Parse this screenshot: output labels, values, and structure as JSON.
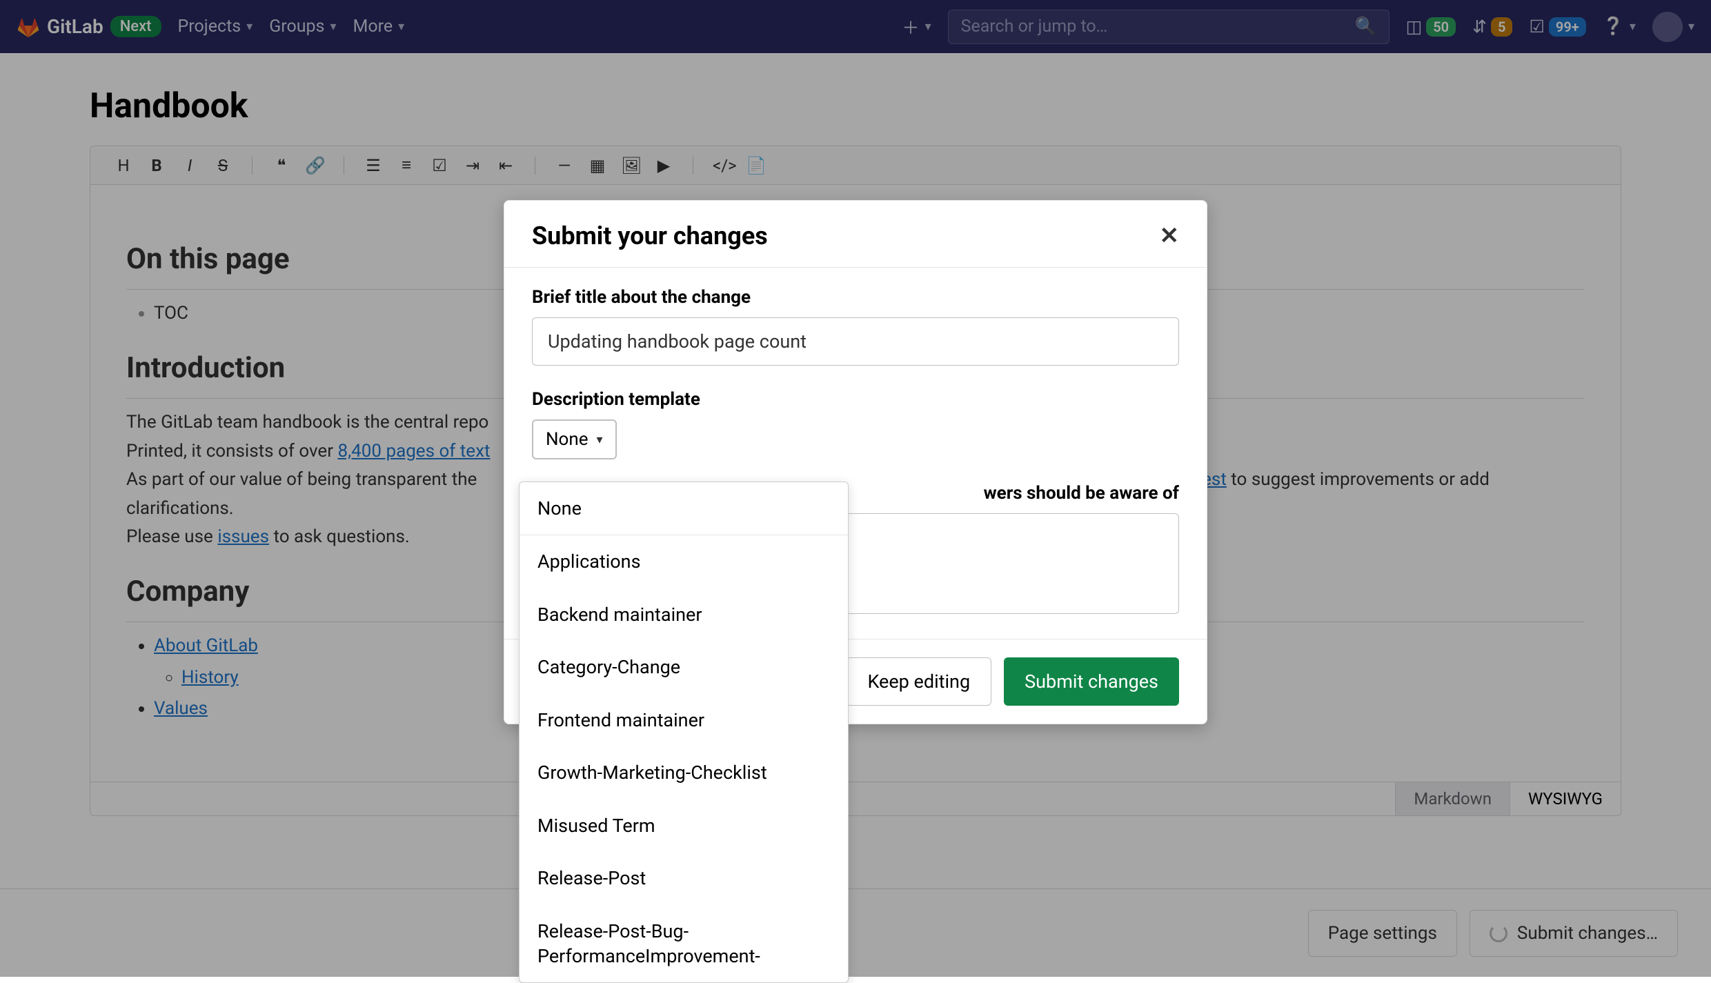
{
  "nav": {
    "brand": "GitLab",
    "next_badge": "Next",
    "items": [
      "Projects",
      "Groups",
      "More"
    ],
    "search_placeholder": "Search or jump to…",
    "counters": {
      "issues": "50",
      "mr": "5",
      "todos": "99+"
    }
  },
  "page": {
    "title": "Handbook",
    "sections": {
      "toc_title": "On this page",
      "toc_item": "TOC",
      "intro_title": "Introduction",
      "intro_p1a": "The GitLab team handbook is the central repo",
      "intro_p2a": "Printed, it consists of over ",
      "intro_link_pages": "8,400 pages of text",
      "intro_p3a": "As part of our value of being transparent the ",
      "intro_link_mr": "uest",
      "intro_p3b": " to suggest improvements or add clarifications.",
      "intro_p4a": "Please use ",
      "intro_link_issues": "issues",
      "intro_p4b": " to ask questions.",
      "company_title": "Company",
      "links": {
        "about": "About GitLab",
        "history": "History",
        "values": "Values"
      }
    },
    "modes": {
      "markdown": "Markdown",
      "wysiwyg": "WYSIWYG"
    }
  },
  "bottombar": {
    "page_settings": "Page settings",
    "submit_changes": "Submit changes…"
  },
  "modal": {
    "title": "Submit your changes",
    "title_label": "Brief title about the change",
    "title_value": "Updating handbook page count",
    "template_label": "Description template",
    "template_selected": "None",
    "context_label_tail": "wers should be aware of",
    "keep_editing": "Keep editing",
    "submit": "Submit changes"
  },
  "dropdown": {
    "options": [
      "None",
      "Applications",
      "Backend maintainer",
      "Category-Change",
      "Frontend maintainer",
      "Growth-Marketing-Checklist",
      "Misused Term",
      "Release-Post",
      "Release-Post-Bug-PerformanceImprovement-"
    ]
  }
}
